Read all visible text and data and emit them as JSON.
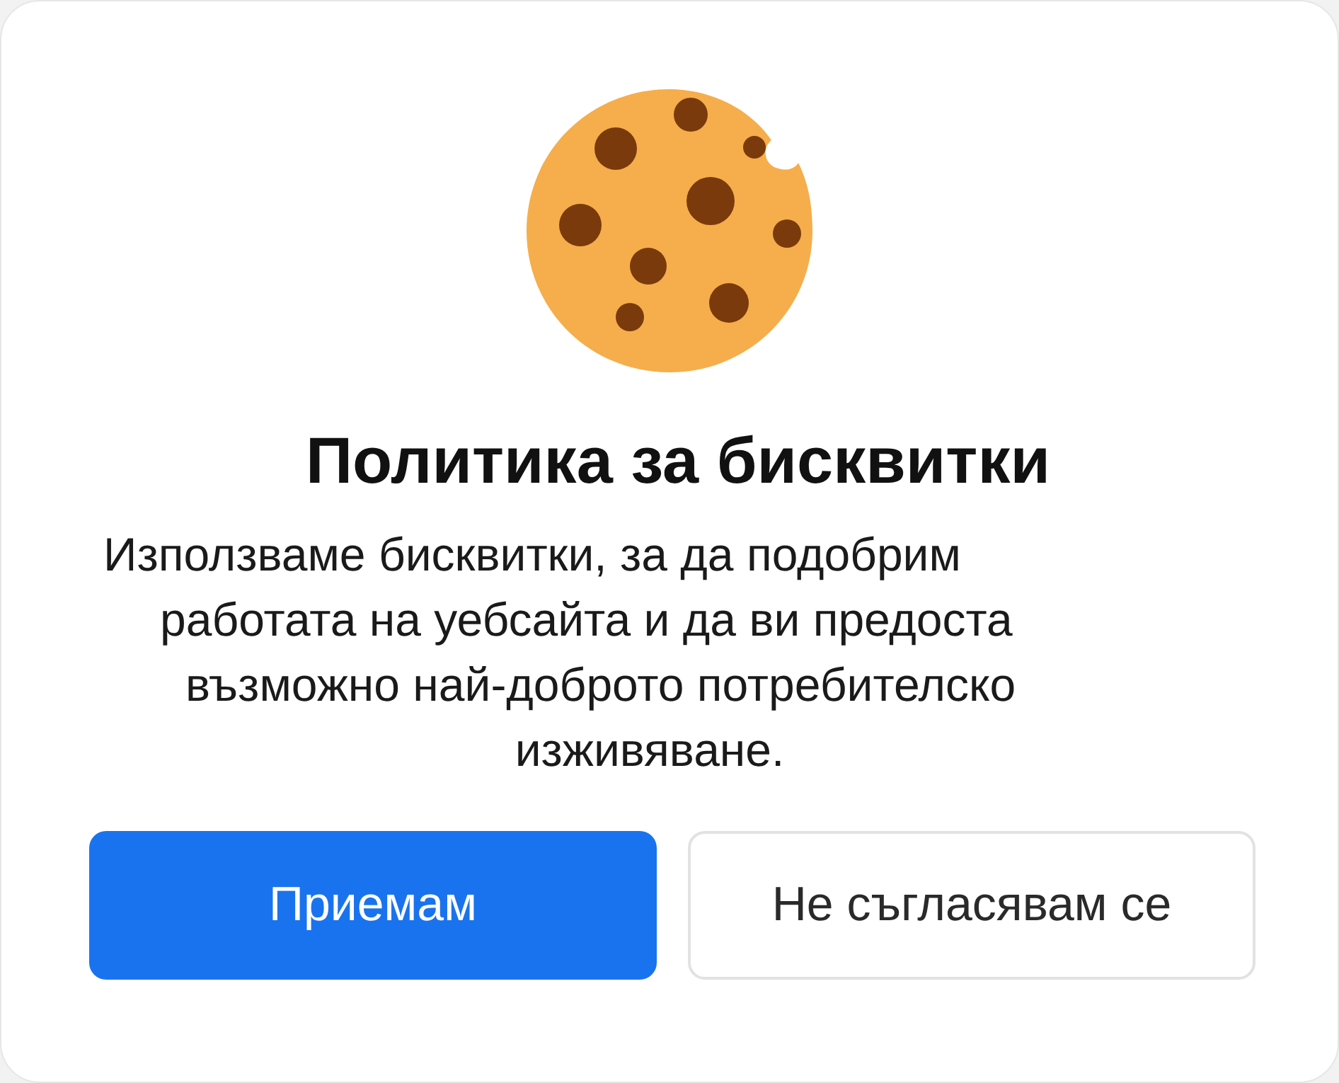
{
  "dialog": {
    "title": "Политика за бисквитки",
    "description_lines": [
      "Използваме бисквитки, за да подобрим",
      "работата на уебсайта и да ви предоста",
      "възможно най-доброто потребителско",
      "изживяване."
    ],
    "buttons": [
      {
        "label": "Приемам",
        "kind": "primary"
      },
      {
        "label": "Не съгласявам се",
        "kind": "secondary"
      }
    ]
  }
}
